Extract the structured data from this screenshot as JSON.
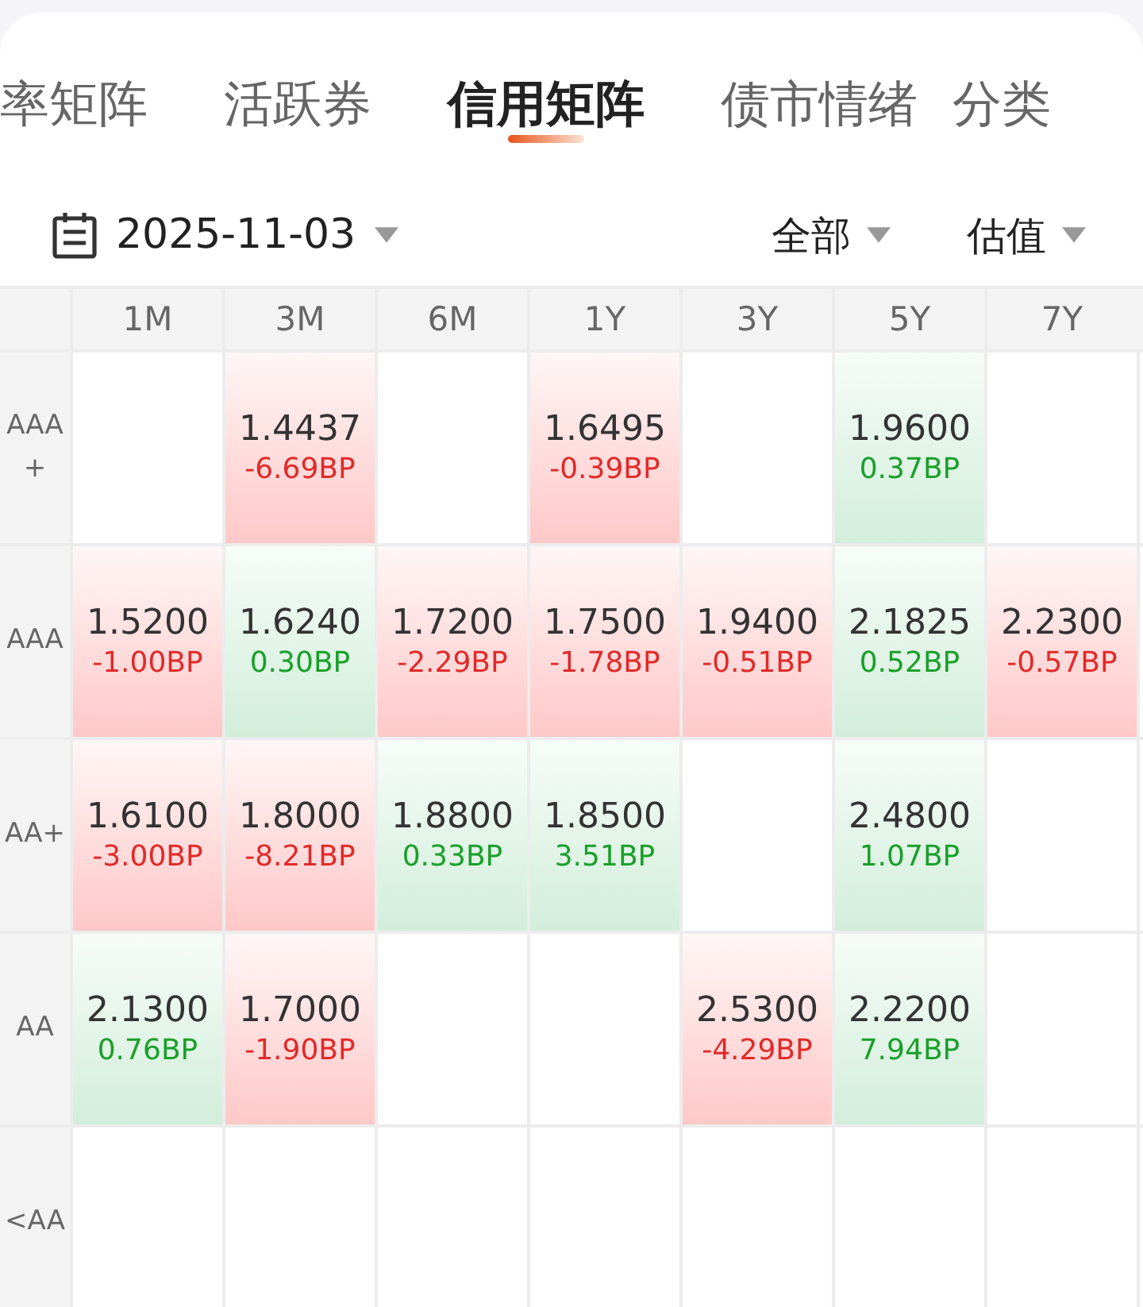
{
  "tabs": [
    {
      "label": "率矩阵",
      "selected": false
    },
    {
      "label": "活跃券",
      "selected": false
    },
    {
      "label": "信用矩阵",
      "selected": true
    },
    {
      "label": "债市情绪",
      "selected": false
    },
    {
      "label": "分类",
      "selected": false
    }
  ],
  "filters": {
    "date": "2025-11-03",
    "scope": "全部",
    "price_type": "估值"
  },
  "table": {
    "columns": [
      "1M",
      "3M",
      "6M",
      "1Y",
      "3Y",
      "5Y",
      "7Y"
    ],
    "rows": [
      {
        "rating": "AAA\n+",
        "cells": [
          {
            "kind": "empty"
          },
          {
            "kind": "fall",
            "yield": "1.4437",
            "change": "-6.69BP"
          },
          {
            "kind": "empty"
          },
          {
            "kind": "fall",
            "yield": "1.6495",
            "change": "-0.39BP"
          },
          {
            "kind": "empty"
          },
          {
            "kind": "rise",
            "yield": "1.9600",
            "change": "0.37BP"
          },
          {
            "kind": "empty"
          }
        ]
      },
      {
        "rating": "AAA",
        "cells": [
          {
            "kind": "fall",
            "yield": "1.5200",
            "change": "-1.00BP"
          },
          {
            "kind": "rise",
            "yield": "1.6240",
            "change": "0.30BP"
          },
          {
            "kind": "fall",
            "yield": "1.7200",
            "change": "-2.29BP"
          },
          {
            "kind": "fall",
            "yield": "1.7500",
            "change": "-1.78BP"
          },
          {
            "kind": "fall",
            "yield": "1.9400",
            "change": "-0.51BP"
          },
          {
            "kind": "rise",
            "yield": "2.1825",
            "change": "0.52BP"
          },
          {
            "kind": "fall",
            "yield": "2.2300",
            "change": "-0.57BP"
          }
        ]
      },
      {
        "rating": "AA+",
        "cells": [
          {
            "kind": "fall",
            "yield": "1.6100",
            "change": "-3.00BP"
          },
          {
            "kind": "fall",
            "yield": "1.8000",
            "change": "-8.21BP"
          },
          {
            "kind": "rise",
            "yield": "1.8800",
            "change": "0.33BP"
          },
          {
            "kind": "rise",
            "yield": "1.8500",
            "change": "3.51BP"
          },
          {
            "kind": "empty"
          },
          {
            "kind": "rise",
            "yield": "2.4800",
            "change": "1.07BP"
          },
          {
            "kind": "empty"
          }
        ]
      },
      {
        "rating": "AA",
        "cells": [
          {
            "kind": "rise",
            "yield": "2.1300",
            "change": "0.76BP"
          },
          {
            "kind": "fall",
            "yield": "1.7000",
            "change": "-1.90BP"
          },
          {
            "kind": "empty"
          },
          {
            "kind": "empty"
          },
          {
            "kind": "fall",
            "yield": "2.5300",
            "change": "-4.29BP"
          },
          {
            "kind": "rise",
            "yield": "2.2200",
            "change": "7.94BP"
          },
          {
            "kind": "empty"
          }
        ]
      },
      {
        "rating": "<AA",
        "cells": [
          {
            "kind": "empty"
          },
          {
            "kind": "empty"
          },
          {
            "kind": "empty"
          },
          {
            "kind": "empty"
          },
          {
            "kind": "empty"
          },
          {
            "kind": "empty"
          },
          {
            "kind": "empty"
          }
        ]
      }
    ]
  }
}
